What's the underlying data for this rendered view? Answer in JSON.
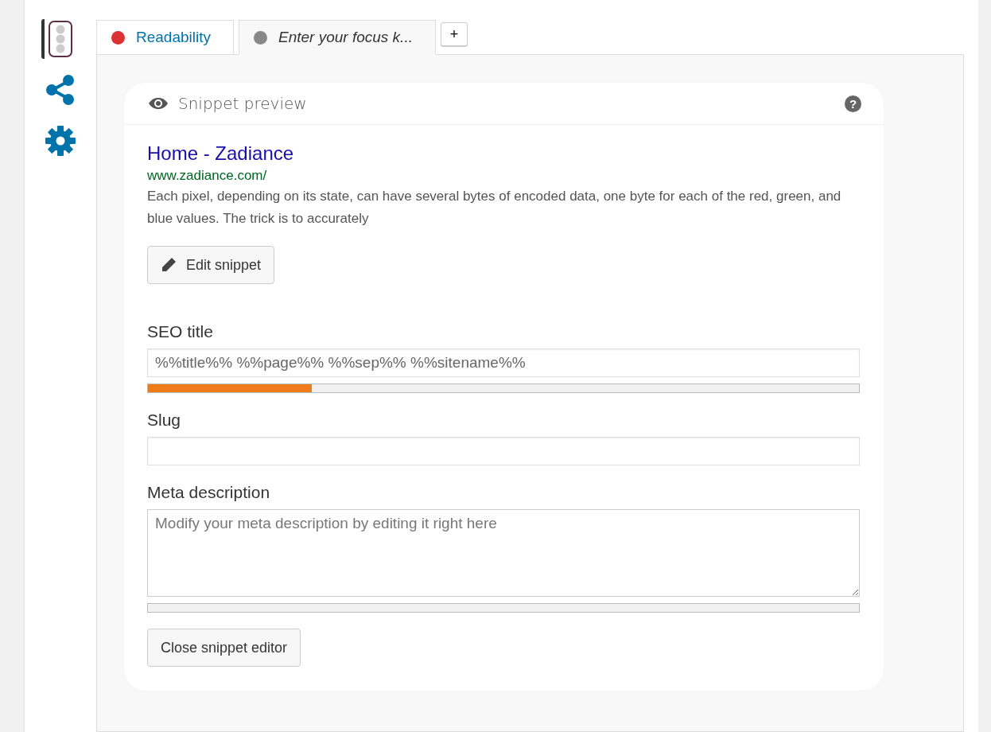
{
  "sidebar": {
    "items": [
      {
        "kind": "traffic-light",
        "selected": true
      },
      {
        "kind": "share",
        "selected": false
      },
      {
        "kind": "gear",
        "selected": false
      }
    ]
  },
  "tabs": [
    {
      "label": "Readability",
      "color": "#dc3232",
      "selected": false,
      "italic": false
    },
    {
      "label": "Enter your focus k...",
      "color": "#888888",
      "selected": true,
      "italic": true
    }
  ],
  "add_tab": "+",
  "snippet": {
    "header": "Snippet preview",
    "help": "?",
    "title": "Home - Zadiance",
    "url": "www.zadiance.com/",
    "description": "Each pixel, depending on its state, can have several bytes of encoded data, one byte for each of the red, green, and blue values. The trick is to accurately",
    "edit_button": "Edit snippet",
    "fields": [
      {
        "label": "SEO title",
        "kind": "input",
        "value": "%%title%% %%page%% %%sep%% %%sitename%%",
        "meter": true,
        "level": 0.23
      },
      {
        "label": "Slug",
        "kind": "input"
      },
      {
        "label": "Meta description",
        "kind": "textarea",
        "placeholder": "Modify your meta description by editing it right here",
        "meter": true,
        "level": 0
      }
    ],
    "close_button": "Close snippet editor"
  }
}
